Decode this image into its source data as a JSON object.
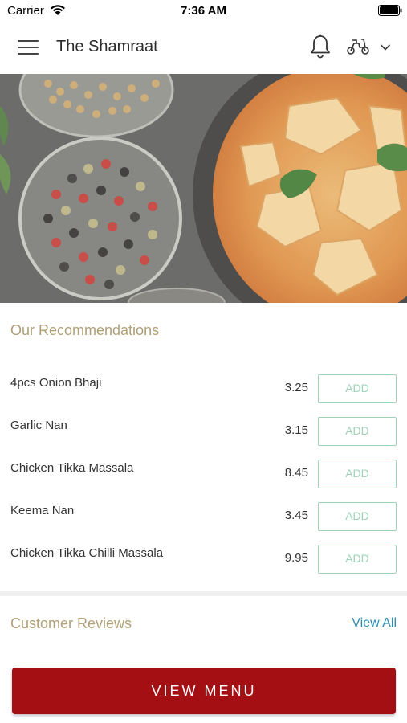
{
  "status_bar": {
    "carrier": "Carrier",
    "time": "7:36 AM"
  },
  "header": {
    "title": "The Shamraat",
    "menu_icon": "hamburger-menu-icon",
    "notification_icon": "bell-icon",
    "delivery_icon": "scooter-icon",
    "dropdown_icon": "chevron-down-icon"
  },
  "recommendations": {
    "title": "Our Recommendations",
    "items": [
      {
        "name": "4pcs Onion Bhaji",
        "price": "3.25",
        "action": "ADD"
      },
      {
        "name": "Garlic Nan",
        "price": "3.15",
        "action": "ADD"
      },
      {
        "name": "Chicken Tikka Massala",
        "price": "8.45",
        "action": "ADD"
      },
      {
        "name": "Keema Nan",
        "price": "3.45",
        "action": "ADD"
      },
      {
        "name": "Chicken Tikka Chilli Massala",
        "price": "9.95",
        "action": "ADD"
      }
    ]
  },
  "reviews": {
    "title": "Customer Reviews",
    "view_all": "View All"
  },
  "footer": {
    "view_menu": "VIEW MENU"
  },
  "colors": {
    "accent_gold": "#b0a078",
    "add_green": "#9fd2b8",
    "link_blue": "#2a8fb8",
    "button_red": "#a30f12"
  }
}
